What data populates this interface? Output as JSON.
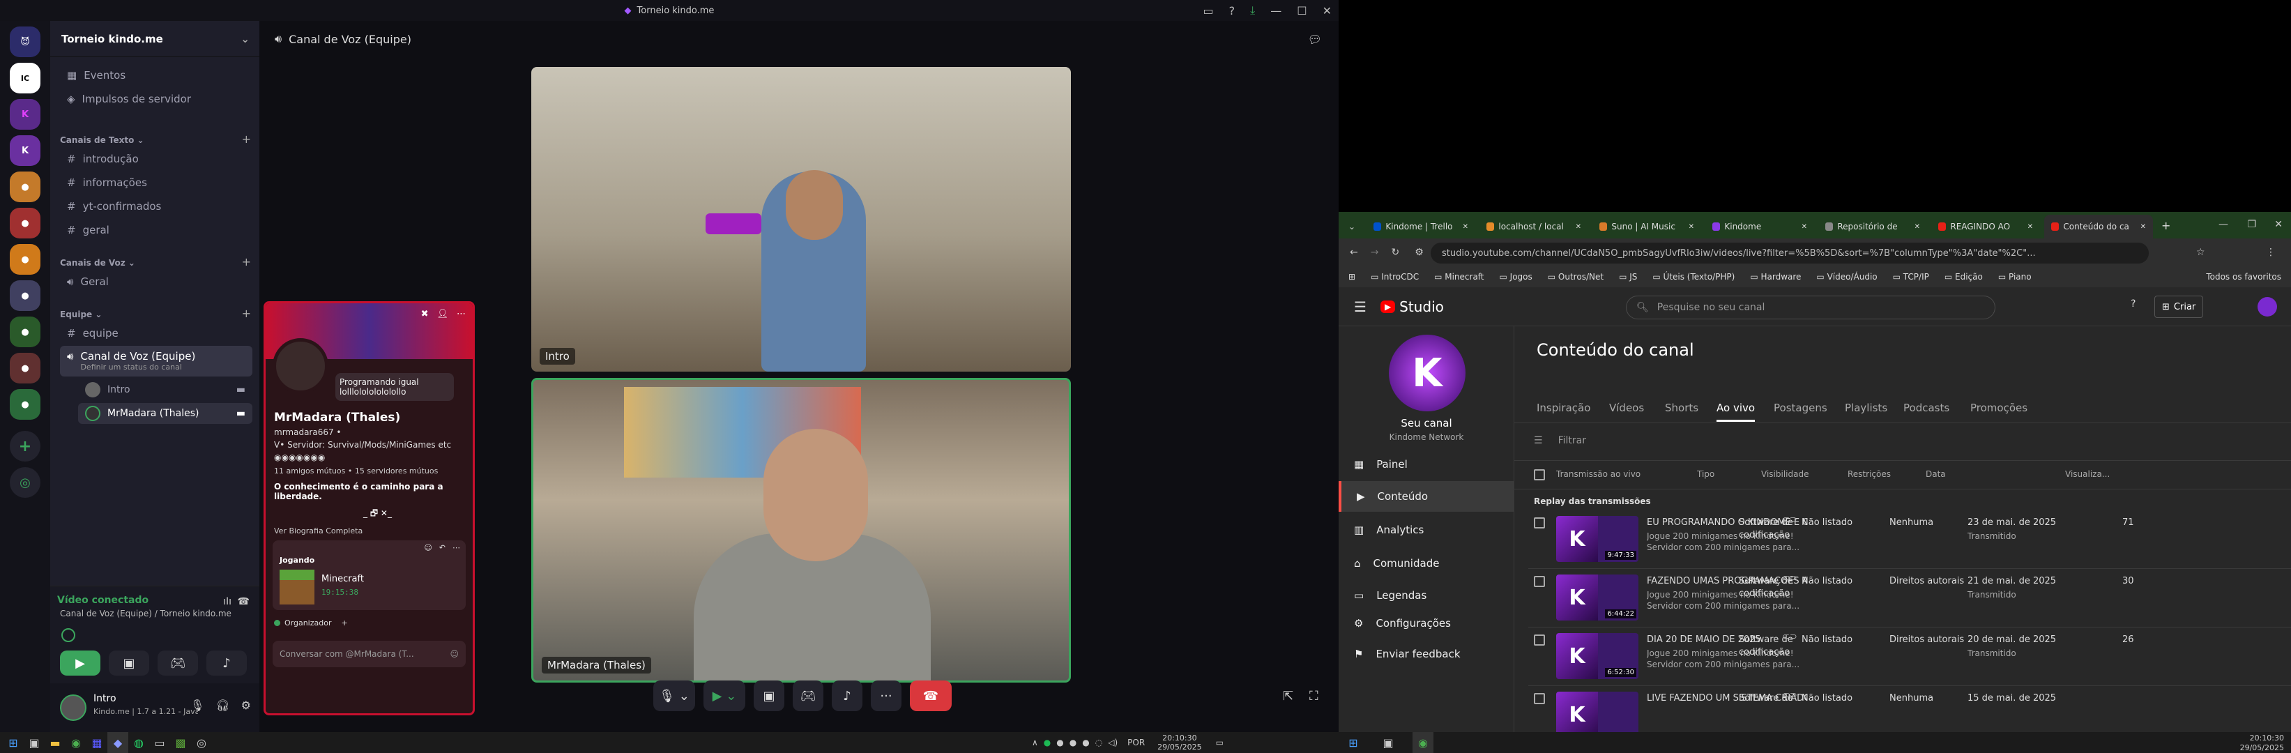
{
  "discord": {
    "window_title": "Torneio kindo.me",
    "server_name": "Torneio kindo.me",
    "server_items": [
      {
        "icon": "calendar-icon",
        "label": "Eventos"
      },
      {
        "icon": "boost-icon",
        "label": "Impulsos de servidor"
      }
    ],
    "categories": {
      "text": {
        "label": "Canais de Texto",
        "channels": [
          "introdução",
          "informações",
          "yt-confirmados",
          "geral"
        ]
      },
      "voice": {
        "label": "Canais de Voz",
        "channels": [
          "Geral"
        ]
      },
      "team": {
        "label": "Equipe",
        "channels": [
          "equipe"
        ]
      }
    },
    "active_voice": {
      "name": "Canal de Voz (Equipe)",
      "status": "Definir um status do canal",
      "members": [
        "Intro",
        "MrMadara (Thales)"
      ]
    },
    "voice_connected": {
      "title": "Vídeo conectado",
      "channel": "Canal de Voz (Equipe) / Torneio kindo.me"
    },
    "user": {
      "name": "Intro",
      "status": "Kindo.me | 1.7 a 1.21 - Java..."
    },
    "stage_title": "Canal de Voz (Equipe)",
    "video_labels": [
      "Intro",
      "MrMadara (Thales)"
    ],
    "profile": {
      "status_bubble": "Programando igual lolllolololololollo",
      "display_name": "MrMadara (Thales)",
      "username": "mrmadara667 •",
      "bio_line": "V• Servidor: Survival/Mods/MiniGames etc",
      "mutuals": "11 amigos mútuos • 15 servidores mútuos",
      "quote": "O conhecimento é o caminho para a liberdade.",
      "quote_tail": "_ 🗗 ✕_",
      "see_bio": "Ver Biografia Completa",
      "playing_header": "Jogando",
      "game": "Minecraft",
      "game_time": "19:15:38",
      "role": "Organizador",
      "message_placeholder": "Conversar com @MrMadara (T..."
    }
  },
  "chrome": {
    "tabs": [
      {
        "label": "Kindome | Trello",
        "color": "#0052cc"
      },
      {
        "label": "localhost / local",
        "color": "#e58b2a"
      },
      {
        "label": "Suno | AI Music",
        "color": "#d97a2a"
      },
      {
        "label": "Kindome",
        "color": "#8a3ae6"
      },
      {
        "label": "Repositório de",
        "color": "#888888"
      },
      {
        "label": "REAGINDO AO",
        "color": "#e62117"
      },
      {
        "label": "Conteúdo do ca",
        "color": "#e62117"
      }
    ],
    "url": "studio.youtube.com/channel/UCdaN5O_pmbSagyUvfRlo3iw/videos/live?filter=%5B%5D&sort=%7B\"columnType\"%3A\"date\"%2C\"...",
    "bookmarks": [
      "IntroCDC",
      "Minecraft",
      "Jogos",
      "Outros/Net",
      "JS",
      "Úteis (Texto/PHP)",
      "Hardware",
      "Vídeo/Áudio",
      "TCP/IP",
      "Edição",
      "Piano"
    ],
    "bookmarks_right": "Todos os favoritos"
  },
  "studio": {
    "logo": "Studio",
    "search_placeholder": "Pesquise no seu canal",
    "create_label": "Criar",
    "channel_label": "Seu canal",
    "channel_name": "Kindome Network",
    "nav": [
      "Painel",
      "Conteúdo",
      "Analytics",
      "Comunidade",
      "Legendas",
      "Configurações",
      "Enviar feedback"
    ],
    "page_title": "Conteúdo do canal",
    "tabs": [
      "Inspiração",
      "Vídeos",
      "Shorts",
      "Ao vivo",
      "Postagens",
      "Playlists",
      "Podcasts",
      "Promoções"
    ],
    "filter_placeholder": "Filtrar",
    "columns": [
      "Transmissão ao vivo",
      "Tipo",
      "Visibilidade",
      "Restrições",
      "Data",
      "Visualiza..."
    ],
    "section": "Replay das transmissões",
    "rows": [
      {
        "title": "EU PROGRAMANDO O KINDOME E OU...",
        "desc1": "Jogue 200 minigames no Kindome!",
        "desc2": "Servidor com 200 minigames para...",
        "duration": "9:47:33",
        "type1": "Software de",
        "type2": "codificação",
        "visibility": "Não listado",
        "restriction": "Nenhuma",
        "date": "23 de mai. de 2025",
        "date_sub": "Transmitido",
        "views": "71"
      },
      {
        "title": "FAZENDO UMAS PROGRAMAÇÕES AL...",
        "desc1": "Jogue 200 minigames no Kindome!",
        "desc2": "Servidor com 200 minigames para...",
        "duration": "6:44:22",
        "type1": "Software de",
        "type2": "codificação",
        "visibility": "Não listado",
        "restriction": "Direitos autorais",
        "date": "21 de mai. de 2025",
        "date_sub": "Transmitido",
        "views": "30"
      },
      {
        "title": "DIA 20 DE MAIO DE 2025",
        "desc1": "Jogue 200 minigames no Kindome!",
        "desc2": "Servidor com 200 minigames para...",
        "duration": "6:52:30",
        "type1": "Software de",
        "type2": "codificação",
        "visibility": "Não listado",
        "restriction": "Direitos autorais",
        "date": "20 de mai. de 2025",
        "date_sub": "Transmitido",
        "views": "26"
      },
      {
        "title": "LIVE FAZENDO UM SISTEMA CRIADO...",
        "desc1": "",
        "desc2": "",
        "duration": "",
        "type1": "Software de",
        "type2": "",
        "visibility": "Não listado",
        "restriction": "Nenhuma",
        "date": "15 de mai. de 2025",
        "date_sub": "",
        "views": ""
      }
    ]
  },
  "taskbar": {
    "lang": "POR",
    "time": "20:10:30",
    "date": "29/05/2025",
    "time2": "20:10:30",
    "date2": "29/05/2025"
  }
}
